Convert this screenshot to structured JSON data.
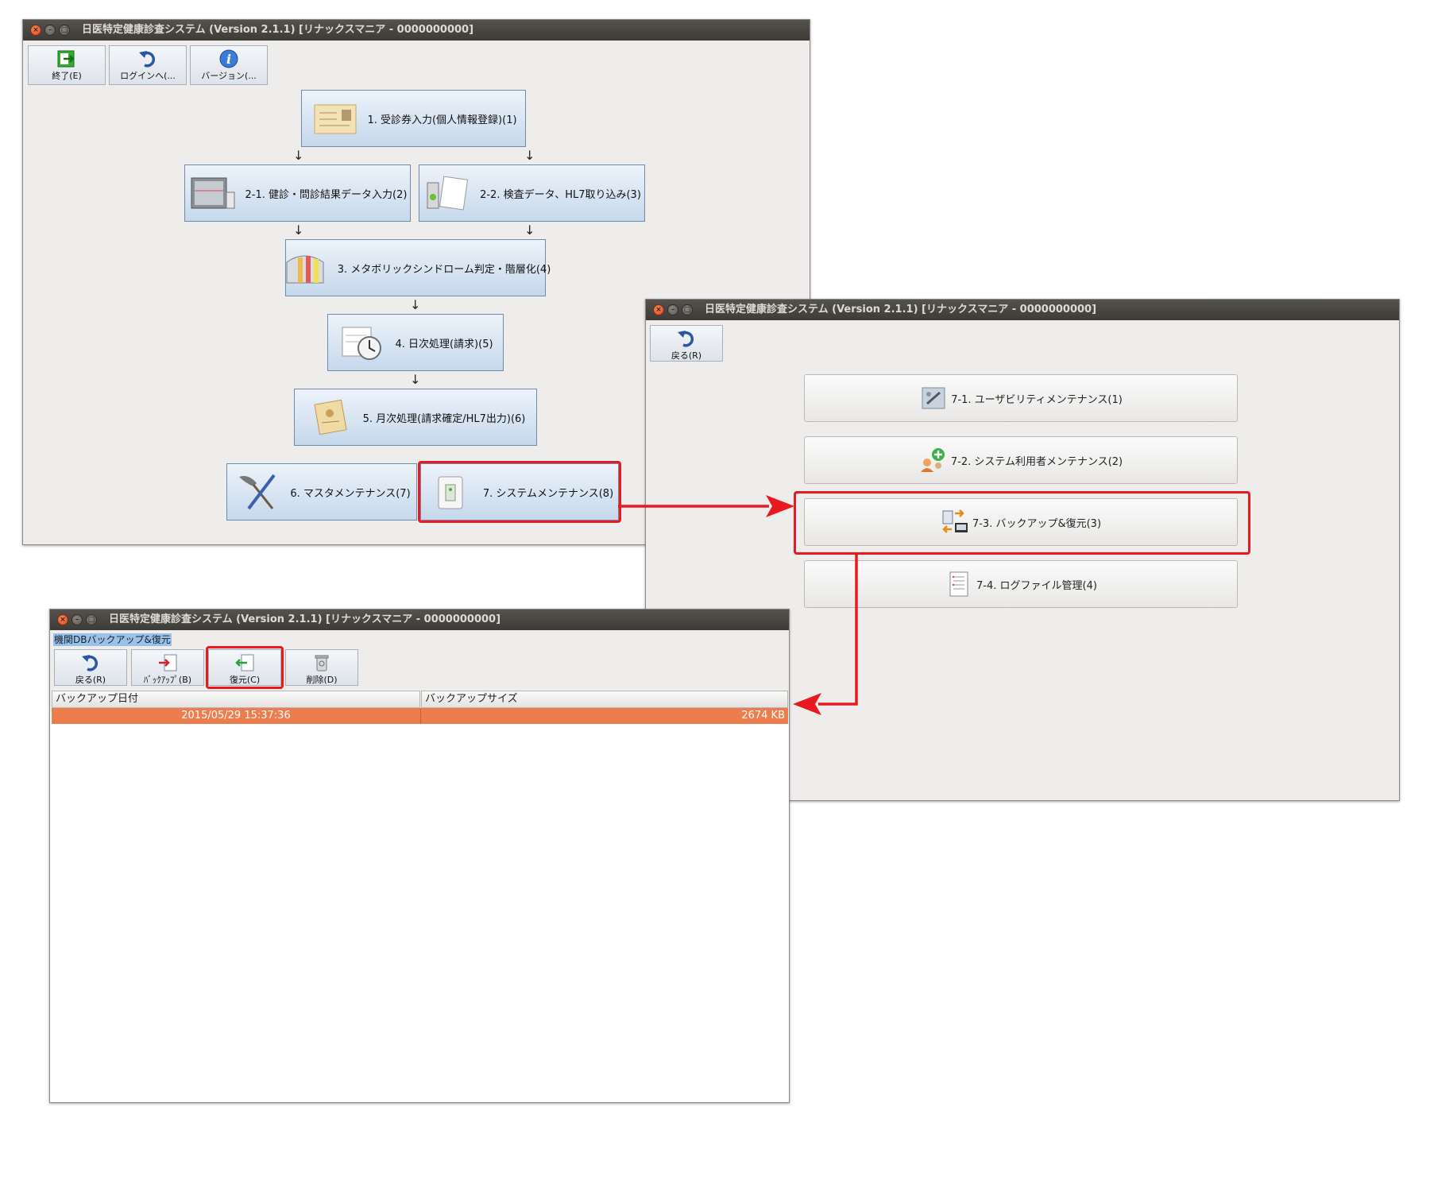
{
  "window1": {
    "title": "日医特定健康診査システム (Version 2.1.1) [リナックスマニア - 0000000000]",
    "toolbar": [
      {
        "label": "終了(E)",
        "icon": "exit-icon"
      },
      {
        "label": "ログインへ(...",
        "icon": "undo-icon"
      },
      {
        "label": "バージョン(...",
        "icon": "info-icon"
      }
    ],
    "flow": {
      "step1": "1. 受診券入力(個人情報登録)(1)",
      "step2_1": "2-1. 健診・問診結果データ入力(2)",
      "step2_2": "2-2. 検査データ、HL7取り込み(3)",
      "step3": "3. メタボリックシンドローム判定・階層化(4)",
      "step4": "4. 日次処理(請求)(5)",
      "step5": "5. 月次処理(請求確定/HL7出力)(6)",
      "step6": "6. マスタメンテナンス(7)",
      "step7": "7. システムメンテナンス(8)"
    },
    "arrow_glyph": "↓"
  },
  "window2": {
    "title": "日医特定健康診査システム (Version 2.1.1) [リナックスマニア - 0000000000]",
    "back_label": "戻る(R)",
    "menu": {
      "m1": "7-1. ユーザビリティメンテナンス(1)",
      "m2": "7-2. システム利用者メンテナンス(2)",
      "m3": "7-3. バックアップ&復元(3)",
      "m4": "7-4. ログファイル管理(4)"
    }
  },
  "window3": {
    "title": "日医特定健康診査システム (Version 2.1.1) [リナックスマニア - 0000000000]",
    "subtitle": "機関DBバックアップ&復元",
    "toolbar": {
      "back": "戻る(R)",
      "backup": "ﾊﾞｯｸｱｯﾌﾟ(B)",
      "restore": "復元(C)",
      "delete": "削除(D)"
    },
    "table": {
      "columns": [
        "バックアップ日付",
        "バックアップサイズ"
      ],
      "rows": [
        {
          "date": "2015/05/29 15:37:36",
          "size": "2674 KB"
        }
      ]
    }
  },
  "colors": {
    "highlight_red": "#e8191f",
    "selected_row": "#ee7d4e",
    "titlebar": "#3c3b37"
  }
}
